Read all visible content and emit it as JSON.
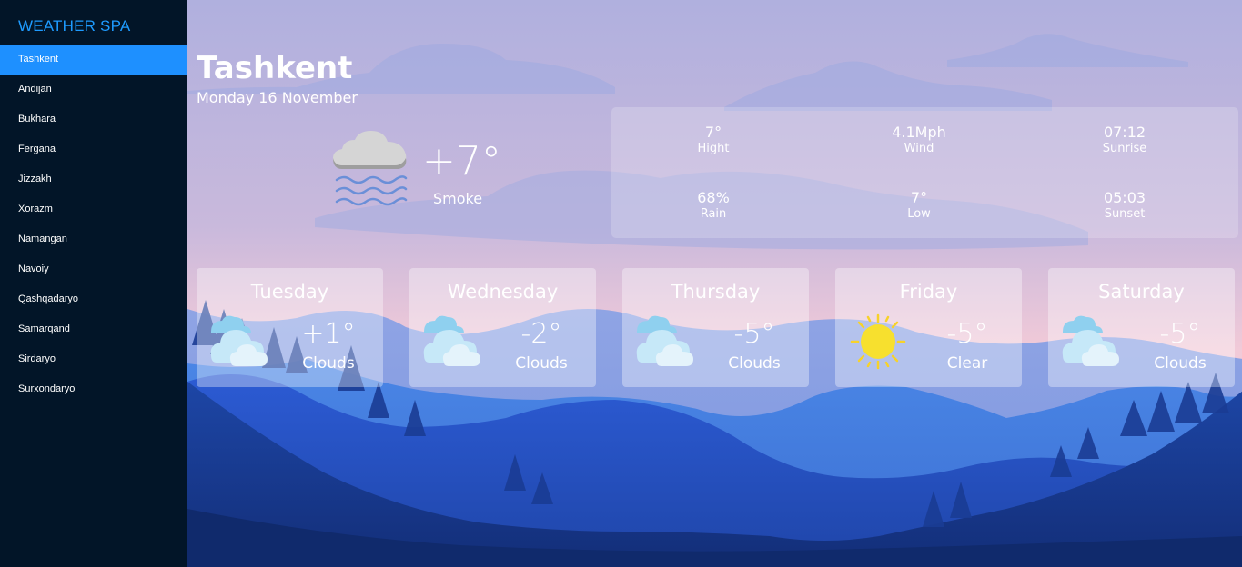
{
  "app": {
    "brand": "WEATHER SPA"
  },
  "sidebar": {
    "items": [
      {
        "label": "Tashkent",
        "active": true
      },
      {
        "label": "Andijan"
      },
      {
        "label": "Bukhara"
      },
      {
        "label": "Fergana"
      },
      {
        "label": "Jizzakh"
      },
      {
        "label": "Xorazm"
      },
      {
        "label": "Namangan"
      },
      {
        "label": "Navoiy"
      },
      {
        "label": "Qashqadaryo"
      },
      {
        "label": "Samarqand"
      },
      {
        "label": "Sirdaryo"
      },
      {
        "label": "Surxondaryo"
      }
    ]
  },
  "current": {
    "city": "Tashkent",
    "date": "Monday 16 November",
    "temp": "+7°",
    "description": "Smoke",
    "icon": "smoke-cloud-icon"
  },
  "stats": {
    "high": {
      "value": "7°",
      "label": "Hight"
    },
    "wind": {
      "value": "4.1Mph",
      "label": "Wind"
    },
    "sunrise": {
      "value": "07:12",
      "label": "Sunrise"
    },
    "rain": {
      "value": "68%",
      "label": "Rain"
    },
    "low": {
      "value": "7°",
      "label": "Low"
    },
    "sunset": {
      "value": "05:03",
      "label": "Sunset"
    }
  },
  "forecast": [
    {
      "day": "Tuesday",
      "temp": "+1°",
      "description": "Clouds",
      "icon": "clouds-icon"
    },
    {
      "day": "Wednesday",
      "temp": "-2°",
      "description": "Clouds",
      "icon": "clouds-icon"
    },
    {
      "day": "Thursday",
      "temp": "-5°",
      "description": "Clouds",
      "icon": "clouds-icon"
    },
    {
      "day": "Friday",
      "temp": "-5°",
      "description": "Clear",
      "icon": "sun-icon"
    },
    {
      "day": "Saturday",
      "temp": "-5°",
      "description": "Clouds",
      "icon": "clouds-icon"
    }
  ],
  "colors": {
    "sidebar_bg": "#021528",
    "accent": "#1e90ff",
    "brand": "#1e9bff",
    "sky_top": "#b4b2dc",
    "sky_bottom": "#e6c6d6",
    "mountain_dark": "#1b3e8f"
  }
}
